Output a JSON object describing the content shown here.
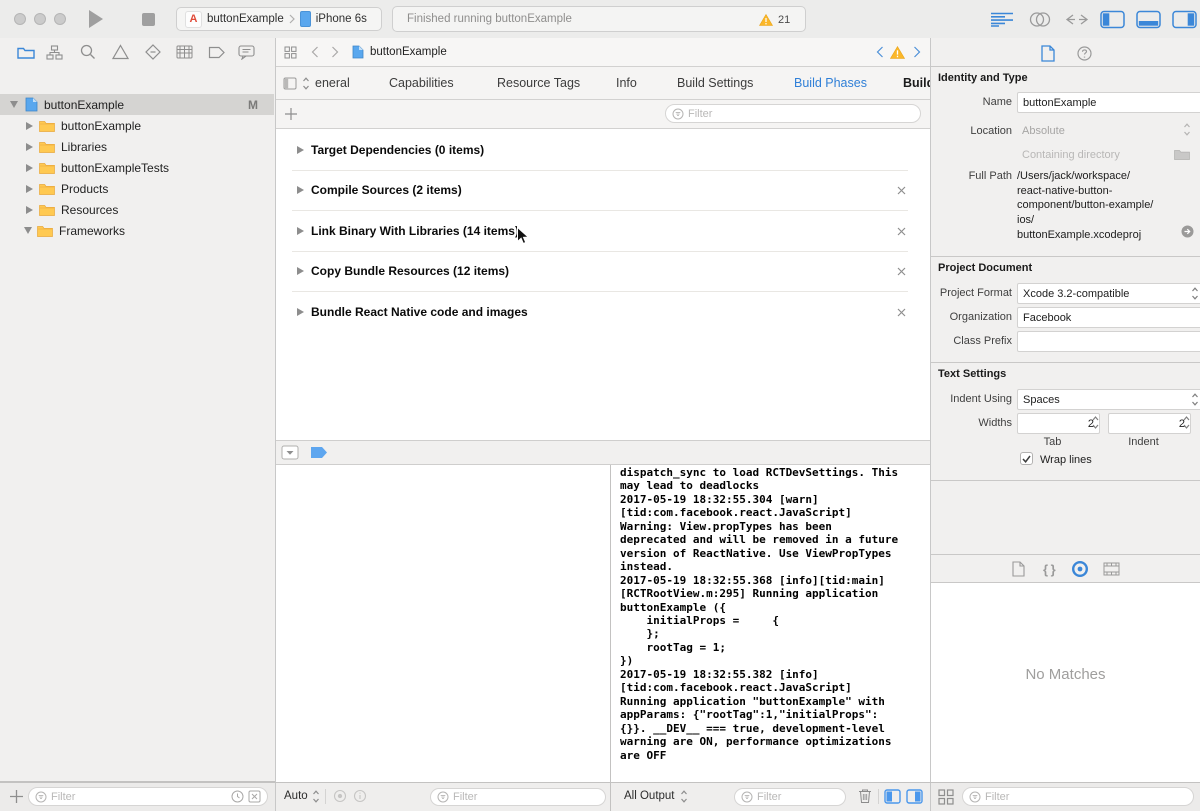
{
  "toolbar": {
    "scheme_name": "buttonExample",
    "scheme_device": "iPhone 6s",
    "status_text": "Finished running buttonExample",
    "warning_count": "21"
  },
  "navigator": {
    "project": "buttonExample",
    "project_badge": "M",
    "items": [
      "buttonExample",
      "Libraries",
      "buttonExampleTests",
      "Products",
      "Resources",
      "Frameworks"
    ],
    "filter_placeholder": "Filter"
  },
  "jumpbar": {
    "title": "buttonExample"
  },
  "editor": {
    "tabs": [
      "eneral",
      "Capabilities",
      "Resource Tags",
      "Info",
      "Build Settings",
      "Build Phases",
      "Build"
    ],
    "active_tab": "Build Phases",
    "filter_placeholder": "Filter",
    "phases": [
      "Target Dependencies (0 items)",
      "Compile Sources (2 items)",
      "Link Binary With Libraries (14 items)",
      "Copy Bundle Resources (12 items)",
      "Bundle React Native code and images"
    ]
  },
  "debug": {
    "scope": "Auto",
    "filter_placeholder": "Filter",
    "output_scope": "All Output",
    "console_filter_placeholder": "Filter",
    "console_text": "dispatch_sync to load RCTDevSettings. This\nmay lead to deadlocks\n2017-05-19 18:32:55.304 [warn]\n[tid:com.facebook.react.JavaScript]\nWarning: View.propTypes has been\ndeprecated and will be removed in a future\nversion of ReactNative. Use ViewPropTypes\ninstead.\n2017-05-19 18:32:55.368 [info][tid:main]\n[RCTRootView.m:295] Running application\nbuttonExample ({\n    initialProps =     {\n    };\n    rootTag = 1;\n})\n2017-05-19 18:32:55.382 [info]\n[tid:com.facebook.react.JavaScript]\nRunning application \"buttonExample\" with\nappParams: {\"rootTag\":1,\"initialProps\":\n{}}. __DEV__ === true, development-level\nwarning are ON, performance optimizations\nare OFF"
  },
  "inspector": {
    "identity": {
      "title": "Identity and Type",
      "name_label": "Name",
      "name_value": "buttonExample",
      "location_label": "Location",
      "location_value": "Absolute",
      "containing_directory": "Containing directory",
      "full_path_label": "Full Path",
      "full_path_value": "/Users/jack/workspace/\nreact-native-button-\ncomponent/button-example/\nios/\nbuttonExample.xcodeproj"
    },
    "project_document": {
      "title": "Project Document",
      "format_label": "Project Format",
      "format_value": "Xcode 3.2-compatible",
      "organization_label": "Organization",
      "organization_value": "Facebook",
      "class_prefix_label": "Class Prefix",
      "class_prefix_value": ""
    },
    "text_settings": {
      "title": "Text Settings",
      "indent_label": "Indent Using",
      "indent_value": "Spaces",
      "widths_label": "Widths",
      "tab_width": "2",
      "indent_width": "2",
      "tab_caption": "Tab",
      "indent_caption": "Indent",
      "wrap_label": "Wrap lines"
    }
  },
  "library": {
    "empty_text": "No Matches",
    "filter_placeholder": "Filter"
  }
}
